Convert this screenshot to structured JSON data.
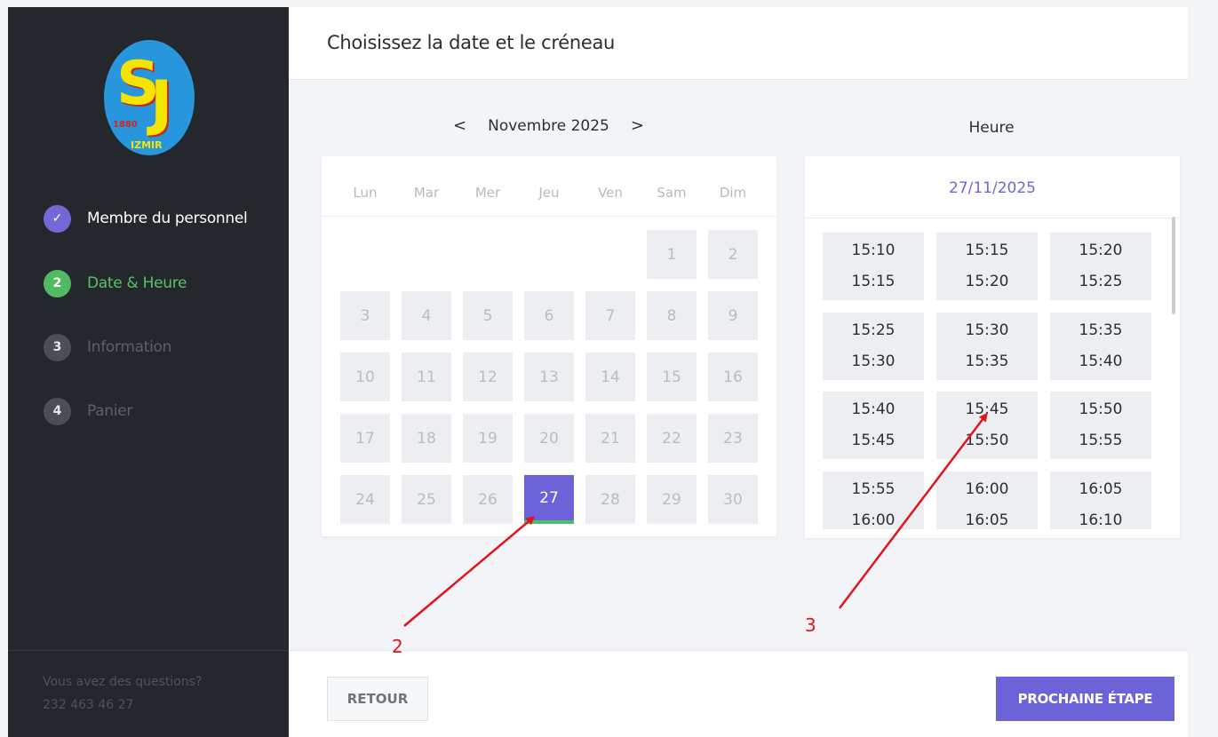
{
  "logo": {
    "letters_s": "S",
    "letters_j": "J",
    "year": "1880",
    "city": "IZMIR"
  },
  "steps": [
    {
      "label": "Membre du personnel",
      "badge": "✓",
      "state": "done"
    },
    {
      "label": "Date & Heure",
      "badge": "2",
      "state": "active"
    },
    {
      "label": "Information",
      "badge": "3",
      "state": "todo"
    },
    {
      "label": "Panier",
      "badge": "4",
      "state": "todo"
    }
  ],
  "help": {
    "question": "Vous avez des questions?",
    "phone": "232 463 46 27"
  },
  "header": {
    "title": "Choisissez la date et le créneau"
  },
  "calendar": {
    "prev": "<",
    "next": ">",
    "month": "Novembre 2025",
    "weekdays": [
      "Lun",
      "Mar",
      "Mer",
      "Jeu",
      "Ven",
      "Sam",
      "Dim"
    ],
    "days": [
      [
        "",
        "",
        "",
        "",
        "",
        "1",
        "2"
      ],
      [
        "3",
        "4",
        "5",
        "6",
        "7",
        "8",
        "9"
      ],
      [
        "10",
        "11",
        "12",
        "13",
        "14",
        "15",
        "16"
      ],
      [
        "17",
        "18",
        "19",
        "20",
        "21",
        "22",
        "23"
      ],
      [
        "24",
        "25",
        "26",
        "27",
        "28",
        "29",
        "30"
      ]
    ],
    "selected_day": "27"
  },
  "time": {
    "heading": "Heure",
    "selected_date": "27/11/2025",
    "slots": [
      [
        "15:10",
        "15:15"
      ],
      [
        "15:15",
        "15:20"
      ],
      [
        "15:20",
        "15:25"
      ],
      [
        "15:25",
        "15:30"
      ],
      [
        "15:30",
        "15:35"
      ],
      [
        "15:35",
        "15:40"
      ],
      [
        "15:40",
        "15:45"
      ],
      [
        "15:45",
        "15:50"
      ],
      [
        "15:50",
        "15:55"
      ],
      [
        "15:55",
        "16:00"
      ],
      [
        "16:00",
        "16:05"
      ],
      [
        "16:05",
        "16:10"
      ]
    ]
  },
  "footer": {
    "back_label": "RETOUR",
    "next_label": "PROCHAINE ÉTAPE"
  },
  "annotations": {
    "label_2": "2",
    "label_3": "3",
    "color": "#e0161c"
  },
  "colors": {
    "accent": "#6c63d9",
    "success": "#52bb61",
    "sidebar": "#24282d"
  }
}
